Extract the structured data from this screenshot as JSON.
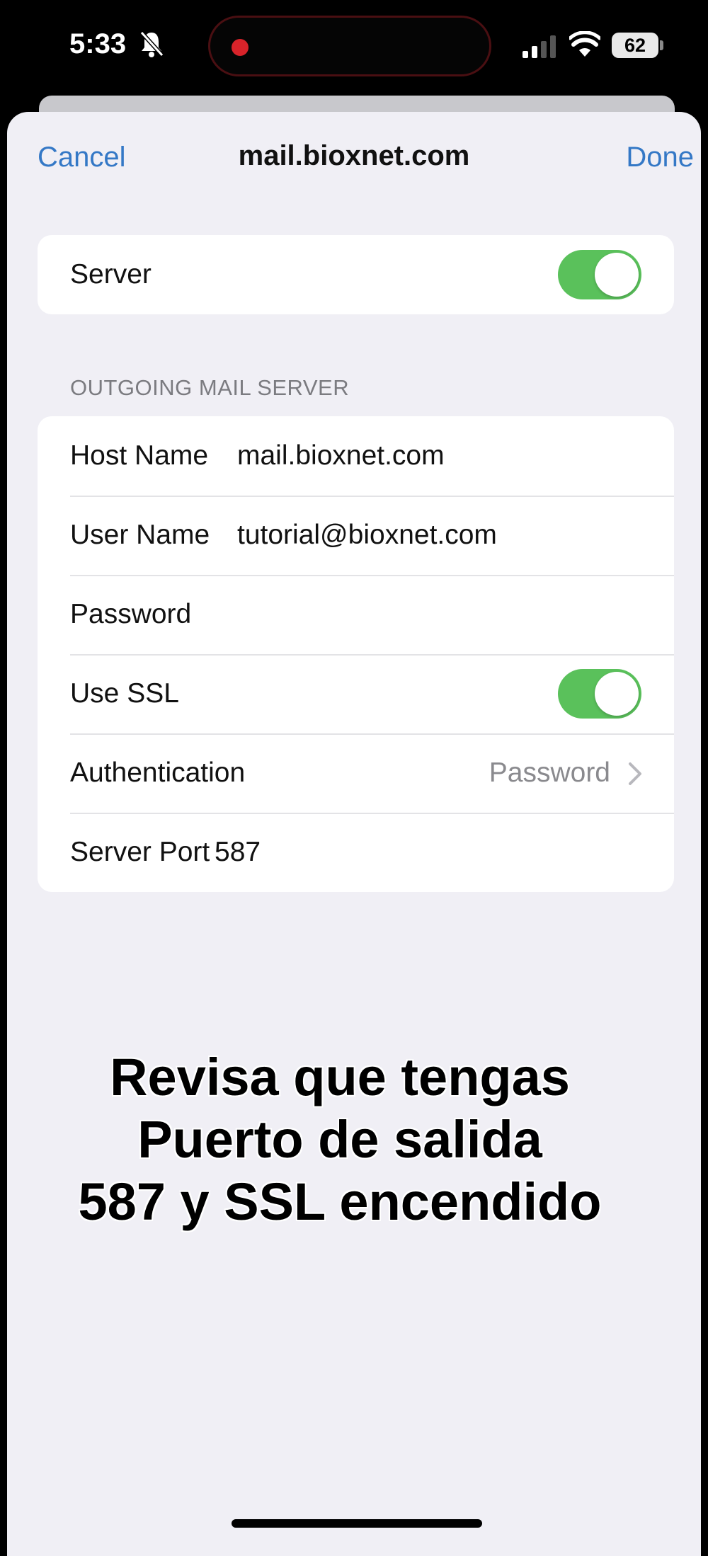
{
  "status_bar": {
    "time": "5:33",
    "battery": "62",
    "icons": [
      "bell-slash-icon",
      "signal-icon",
      "wifi-icon",
      "battery-icon"
    ]
  },
  "nav": {
    "cancel": "Cancel",
    "title": "mail.bioxnet.com",
    "done": "Done"
  },
  "server_toggle": {
    "label": "Server",
    "on": true
  },
  "outgoing": {
    "header": "OUTGOING MAIL SERVER",
    "host_label": "Host Name",
    "host_value": "mail.bioxnet.com",
    "user_label": "User Name",
    "user_value": "tutorial@bioxnet.com",
    "password_label": "Password",
    "ssl_label": "Use SSL",
    "ssl_on": true,
    "auth_label": "Authentication",
    "auth_value": "Password",
    "port_label": "Server Port",
    "port_value": "587"
  },
  "caption": {
    "line1": "Revisa que tengas",
    "line2": "Puerto de salida",
    "line3": "587 y SSL encendido"
  },
  "colors": {
    "accent": "#3478c6",
    "toggle_on": "#5ac15b",
    "background": "#f0eff5"
  }
}
